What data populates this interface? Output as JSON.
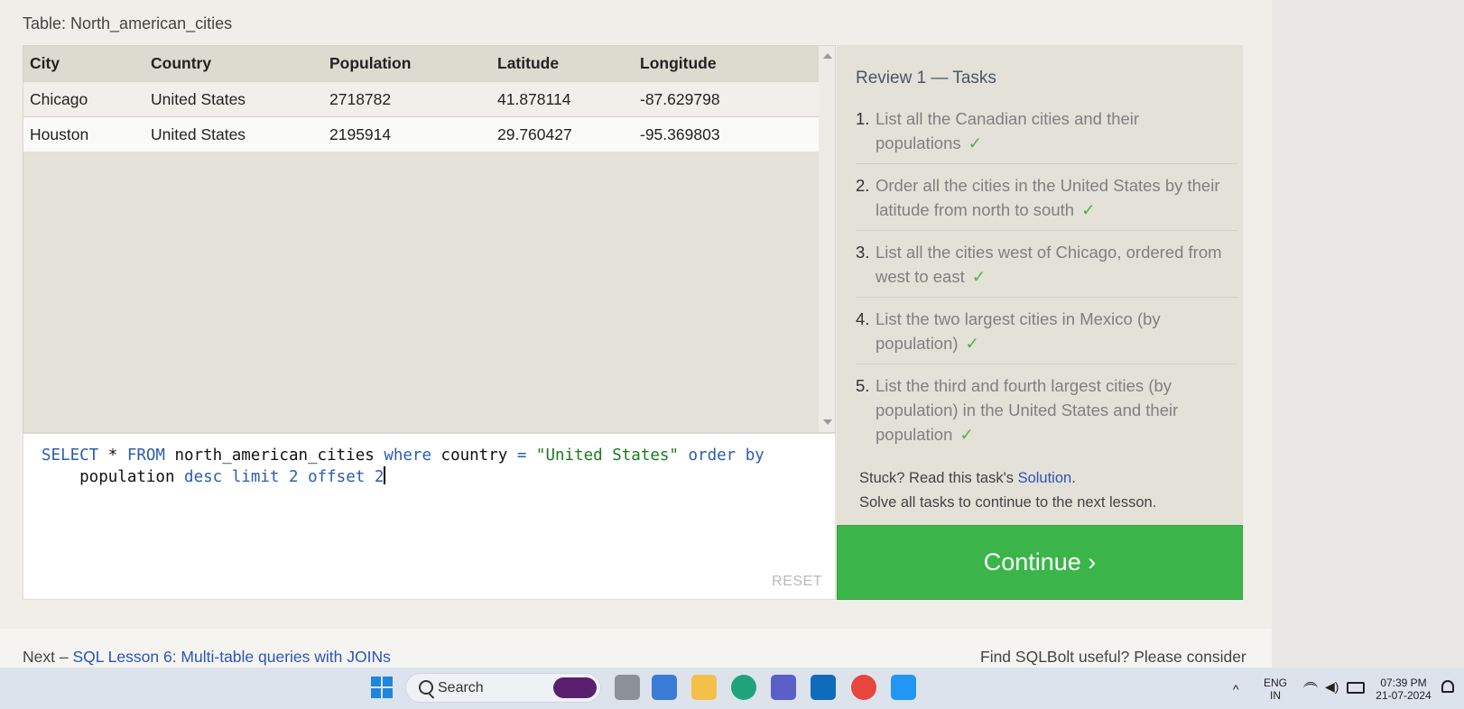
{
  "table_title": "Table: North_american_cities",
  "results": {
    "columns": [
      "City",
      "Country",
      "Population",
      "Latitude",
      "Longitude"
    ],
    "rows": [
      [
        "Chicago",
        "United States",
        "2718782",
        "41.878114",
        "-87.629798"
      ],
      [
        "Houston",
        "United States",
        "2195914",
        "29.760427",
        "-95.369803"
      ]
    ]
  },
  "editor": {
    "line1_parts": [
      "SELECT",
      " * ",
      "FROM",
      " north_american_cities ",
      "where",
      " country ",
      "=",
      " ",
      "\"United States\"",
      " ",
      "order by"
    ],
    "line2_parts": [
      "    population ",
      "desc",
      " ",
      "limit",
      " ",
      "2",
      " ",
      "offset",
      " ",
      "2"
    ],
    "reset_label": "RESET"
  },
  "tasks_panel": {
    "title": "Review 1 — Tasks",
    "tasks": [
      {
        "num": "1.",
        "text": "List all the Canadian cities and their populations",
        "check": "✓"
      },
      {
        "num": "2.",
        "text": "Order all the cities in the United States by their latitude from north to south",
        "check": "✓"
      },
      {
        "num": "3.",
        "text": "List all the cities west of Chicago, ordered from west to east",
        "check": "✓"
      },
      {
        "num": "4.",
        "text": "List the two largest cities in Mexico (by population)",
        "check": "✓"
      },
      {
        "num": "5.",
        "text": "List the third and fourth largest cities (by population) in the United States and their population",
        "check": "✓"
      }
    ],
    "stuck_prefix": "Stuck? Read this task's ",
    "solution_link": "Solution",
    "stuck_suffix": ".",
    "solve_all": "Solve all tasks to continue to the next lesson."
  },
  "continue_button": "Continue ›",
  "footer": {
    "next_prefix": "Next – ",
    "next_link": "SQL Lesson 6: Multi-table queries with JOINs",
    "useful": "Find SQLBolt useful? Please consider"
  },
  "taskbar": {
    "search_placeholder": "Search",
    "language": "ENG",
    "region": "IN",
    "time": "07:39 PM",
    "date": "21-07-2024",
    "accent_color": "#3bb54a"
  }
}
